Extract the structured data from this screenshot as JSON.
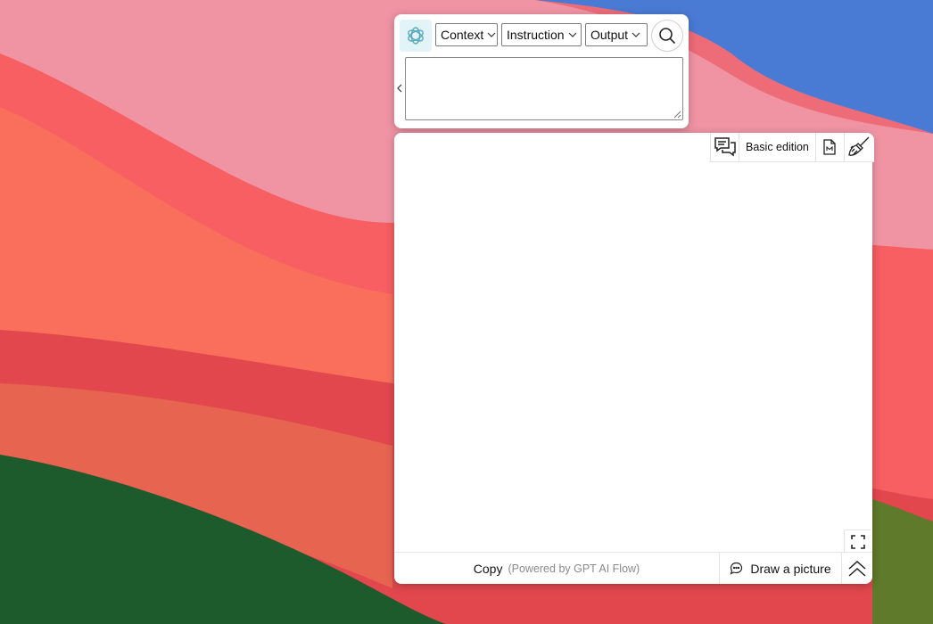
{
  "toolbar_top": {
    "dropdowns": [
      {
        "label": "Context"
      },
      {
        "label": "Instruction"
      },
      {
        "label": "Output"
      }
    ],
    "prompt_value": ""
  },
  "panel": {
    "edition_label": "Basic edition",
    "copy_label": "Copy",
    "powered_label": "(Powered by GPT AI Flow)",
    "draw_label": "Draw a picture"
  },
  "icons": {
    "logo": "openai-logo-icon",
    "search": "search-icon",
    "collapse": "chevron-left-icon",
    "chat": "chat-bubbles-icon",
    "markdown": "markdown-file-icon",
    "clear": "broom-icon",
    "fullscreen": "fullscreen-icon",
    "draw": "chat-bubble-icon",
    "scroll_top": "double-chevron-up-icon"
  },
  "colors": {
    "logo_bg": "#e3f4f9",
    "logo_stroke": "#5aa9bd"
  }
}
